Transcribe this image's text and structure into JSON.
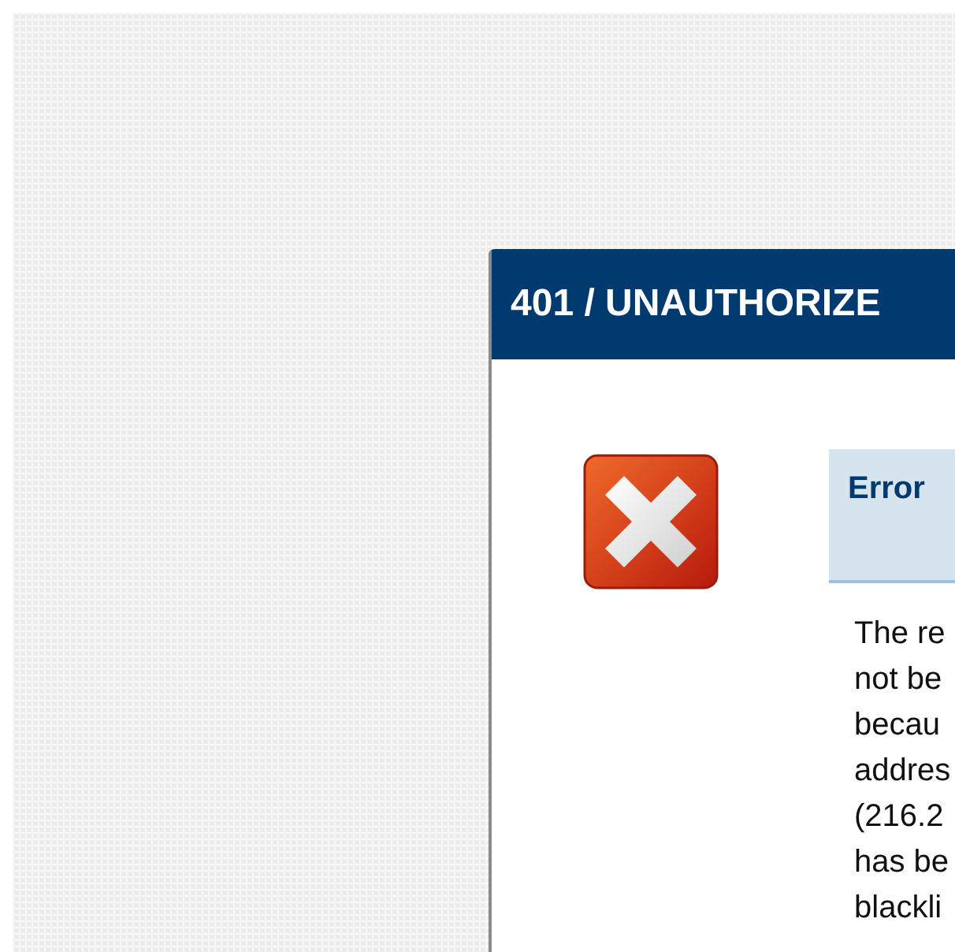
{
  "dialog": {
    "title": "401 / UNAUTHORIZE",
    "error_box": {
      "heading": "Error"
    },
    "message_lines": [
      "The re",
      "not be",
      "becau",
      "addres",
      "(216.2",
      "has be",
      "blackli"
    ]
  }
}
